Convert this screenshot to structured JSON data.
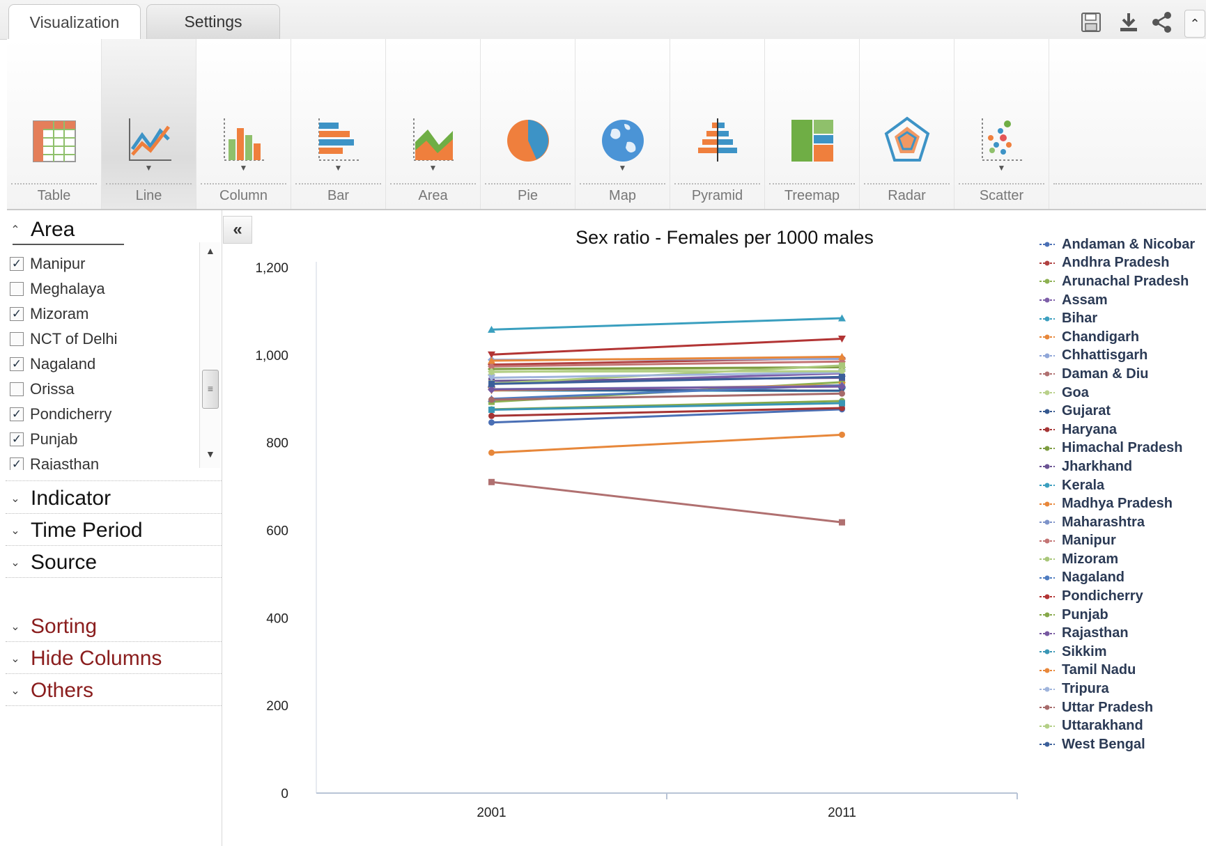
{
  "tabs": [
    {
      "label": "Visualization",
      "active": true
    },
    {
      "label": "Settings",
      "active": false
    }
  ],
  "toolbar_icons": [
    "save-icon",
    "download-icon",
    "share-icon",
    "collapse-up-icon"
  ],
  "ribbon": [
    {
      "label": "Table",
      "icon": "table-icon",
      "dropdown": false,
      "active": false
    },
    {
      "label": "Line",
      "icon": "line-chart-icon",
      "dropdown": true,
      "active": true
    },
    {
      "label": "Column",
      "icon": "column-chart-icon",
      "dropdown": true,
      "active": false
    },
    {
      "label": "Bar",
      "icon": "bar-chart-icon",
      "dropdown": true,
      "active": false
    },
    {
      "label": "Area",
      "icon": "area-chart-icon",
      "dropdown": true,
      "active": false
    },
    {
      "label": "Pie",
      "icon": "pie-chart-icon",
      "dropdown": false,
      "active": false
    },
    {
      "label": "Map",
      "icon": "globe-icon",
      "dropdown": true,
      "active": false
    },
    {
      "label": "Pyramid",
      "icon": "pyramid-chart-icon",
      "dropdown": false,
      "active": false
    },
    {
      "label": "Treemap",
      "icon": "treemap-icon",
      "dropdown": false,
      "active": false
    },
    {
      "label": "Radar",
      "icon": "radar-chart-icon",
      "dropdown": false,
      "active": false
    },
    {
      "label": "Scatter",
      "icon": "scatter-chart-icon",
      "dropdown": true,
      "active": false
    }
  ],
  "left_panel": {
    "area": {
      "title": "Area",
      "items": [
        {
          "label": "Manipur",
          "checked": true
        },
        {
          "label": "Meghalaya",
          "checked": false
        },
        {
          "label": "Mizoram",
          "checked": true
        },
        {
          "label": "NCT of Delhi",
          "checked": false
        },
        {
          "label": "Nagaland",
          "checked": true
        },
        {
          "label": "Orissa",
          "checked": false
        },
        {
          "label": "Pondicherry",
          "checked": true
        },
        {
          "label": "Punjab",
          "checked": true
        },
        {
          "label": "Rajasthan",
          "checked": true
        }
      ]
    },
    "sections": [
      "Indicator",
      "Time Period",
      "Source"
    ],
    "option_sections": [
      "Sorting",
      "Hide Columns",
      "Others"
    ]
  },
  "chart_data": {
    "type": "line",
    "title": "Sex ratio - Females per 1000 males",
    "xlabel": "",
    "ylabel": "",
    "x": [
      "2001",
      "2011"
    ],
    "ylim": [
      0,
      1200
    ],
    "yticks": [
      0,
      200,
      400,
      600,
      800,
      1000,
      1200
    ],
    "ytick_labels": [
      "0",
      "200",
      "400",
      "600",
      "800",
      "1,000",
      "1,200"
    ],
    "grid": false,
    "legend_position": "right",
    "series": [
      {
        "name": "Andaman & Nicobar",
        "values": [
          846,
          876
        ],
        "color": "#4a6fb5",
        "marker": "circle"
      },
      {
        "name": "Andhra Pradesh",
        "values": [
          978,
          993
        ],
        "color": "#b04141",
        "marker": "diamond"
      },
      {
        "name": "Arunachal Pradesh",
        "values": [
          893,
          938
        ],
        "color": "#8cb050",
        "marker": "square"
      },
      {
        "name": "Assam",
        "values": [
          935,
          958
        ],
        "color": "#7d5ea8",
        "marker": "triangle"
      },
      {
        "name": "Bihar",
        "values": [
          919,
          918
        ],
        "color": "#3c9fbf",
        "marker": "triangle-down"
      },
      {
        "name": "Chandigarh",
        "values": [
          777,
          818
        ],
        "color": "#e7873a",
        "marker": "circle"
      },
      {
        "name": "Chhattisgarh",
        "values": [
          989,
          991
        ],
        "color": "#8fa6d8",
        "marker": "diamond"
      },
      {
        "name": "Daman & Diu",
        "values": [
          710,
          618
        ],
        "color": "#b07070",
        "marker": "square"
      },
      {
        "name": "Goa",
        "values": [
          961,
          973
        ],
        "color": "#b9d08a",
        "marker": "triangle"
      },
      {
        "name": "Gujarat",
        "values": [
          920,
          919
        ],
        "color": "#35588f",
        "marker": "triangle-down"
      },
      {
        "name": "Haryana",
        "values": [
          861,
          879
        ],
        "color": "#a53434",
        "marker": "circle"
      },
      {
        "name": "Himachal Pradesh",
        "values": [
          968,
          972
        ],
        "color": "#7c9b3f",
        "marker": "diamond"
      },
      {
        "name": "Jharkhand",
        "values": [
          941,
          948
        ],
        "color": "#6a5393",
        "marker": "square"
      },
      {
        "name": "Kerala",
        "values": [
          1058,
          1084
        ],
        "color": "#3a9fbf",
        "marker": "triangle"
      },
      {
        "name": "Madhya Pradesh",
        "values": [
          919,
          931
        ],
        "color": "#e8873a",
        "marker": "triangle-down"
      },
      {
        "name": "Maharashtra",
        "values": [
          922,
          929
        ],
        "color": "#7d93c9",
        "marker": "circle"
      },
      {
        "name": "Manipur",
        "values": [
          974,
          985
        ],
        "color": "#c37373",
        "marker": "diamond"
      },
      {
        "name": "Mizoram",
        "values": [
          935,
          976
        ],
        "color": "#a9c77a",
        "marker": "square"
      },
      {
        "name": "Nagaland",
        "values": [
          900,
          931
        ],
        "color": "#4f7cc0",
        "marker": "triangle"
      },
      {
        "name": "Pondicherry",
        "values": [
          1001,
          1037
        ],
        "color": "#b23434",
        "marker": "triangle-down"
      },
      {
        "name": "Punjab",
        "values": [
          876,
          895
        ],
        "color": "#86a84a",
        "marker": "circle"
      },
      {
        "name": "Rajasthan",
        "values": [
          921,
          928
        ],
        "color": "#7658a0",
        "marker": "diamond"
      },
      {
        "name": "Sikkim",
        "values": [
          875,
          890
        ],
        "color": "#3996b5",
        "marker": "square"
      },
      {
        "name": "Tamil Nadu",
        "values": [
          987,
          996
        ],
        "color": "#e8873a",
        "marker": "triangle"
      },
      {
        "name": "Tripura",
        "values": [
          948,
          960
        ],
        "color": "#9fb4dc",
        "marker": "triangle-down"
      },
      {
        "name": "Uttar Pradesh",
        "values": [
          898,
          912
        ],
        "color": "#a66a6a",
        "marker": "circle"
      },
      {
        "name": "Uttarakhand",
        "values": [
          962,
          963
        ],
        "color": "#b3cf86",
        "marker": "diamond"
      },
      {
        "name": "West Bengal",
        "values": [
          934,
          950
        ],
        "color": "#3b5f9a",
        "marker": "square"
      }
    ]
  }
}
